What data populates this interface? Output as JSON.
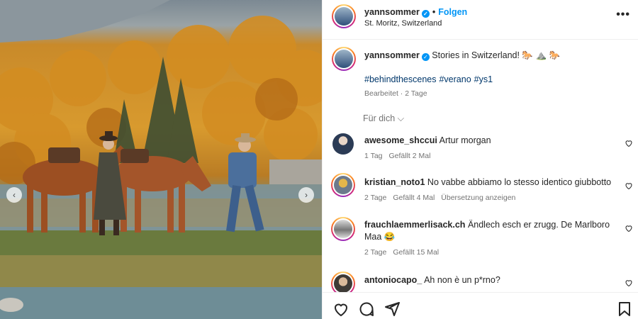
{
  "post": {
    "username": "yannsommer",
    "follow_label": "Folgen",
    "location": "St. Moritz, Switzerland",
    "more_label": "•••"
  },
  "caption": {
    "username": "yannsommer",
    "text": "Stories in Switzerland! 🐎 ⛰️ 🐎",
    "hashtags": [
      "#behindthescenes",
      "#verano",
      "#ys1"
    ],
    "meta": "Bearbeitet · 2 Tage"
  },
  "for_you_label": "Für dich ⌵",
  "comments": [
    {
      "username": "awesome_shccui",
      "text": "Artur morgan",
      "age": "1 Tag",
      "likes": "Gefällt 2 Mal",
      "translate": ""
    },
    {
      "username": "kristian_noto1",
      "text": "No vabbe abbiamo lo stesso identico giubbotto",
      "age": "2 Tage",
      "likes": "Gefällt 4 Mal",
      "translate": "Übersetzung anzeigen"
    },
    {
      "username": "frauchlaemmerlisack.ch",
      "text": "Ändlech esch er zrugg. De Marlboro Maa 😂",
      "age": "2 Tage",
      "likes": "Gefällt 15 Mal",
      "translate": ""
    },
    {
      "username": "antoniocapo_",
      "text": "Ah non è un p*rno?",
      "age": "",
      "likes": "",
      "translate": ""
    }
  ],
  "carousel": {
    "prev": "‹",
    "next": "›"
  },
  "colors": {
    "accent": "#0095f6",
    "hashtag": "#00376b",
    "muted": "#737373"
  },
  "icons": [
    "heart-icon",
    "comment-icon",
    "share-icon",
    "bookmark-icon",
    "verified-icon",
    "more-icon"
  ]
}
